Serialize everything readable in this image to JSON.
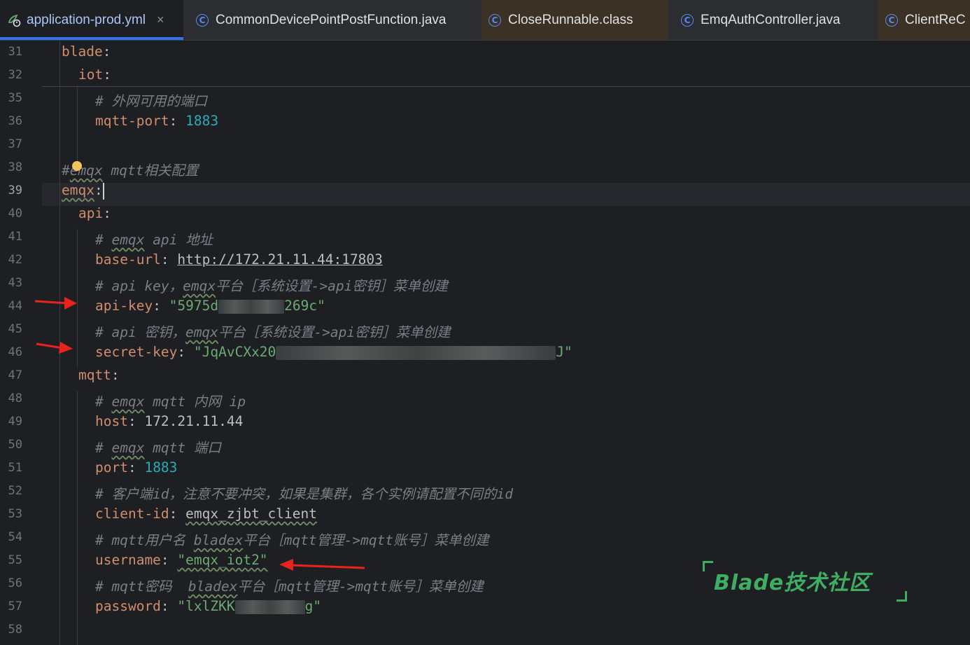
{
  "tabs": [
    {
      "label": "application-prod.yml",
      "close": "×"
    },
    {
      "label": "CommonDevicePointPostFunction.java"
    },
    {
      "label": "CloseRunnable.class"
    },
    {
      "label": "EmqAuthController.java"
    },
    {
      "label": "ClientReC"
    }
  ],
  "class_icon_glyph": "C",
  "lines": [
    {
      "n": "31",
      "indent": 0,
      "key": "blade",
      "sep": ":"
    },
    {
      "n": "32",
      "indent": 1,
      "key": "iot",
      "sep": ":"
    },
    {
      "n": "35",
      "indent": 2,
      "comment": "# 外网可用的端口"
    },
    {
      "n": "36",
      "indent": 2,
      "key": "mqtt-port",
      "sep": ": ",
      "num": "1883"
    },
    {
      "n": "37",
      "indent": 0
    },
    {
      "n": "38",
      "indent": 0,
      "comment": "#emqx mqtt相关配置"
    },
    {
      "n": "39",
      "indent": 0,
      "key": "emqx",
      "sep": ":"
    },
    {
      "n": "40",
      "indent": 1,
      "key": "api",
      "sep": ":"
    },
    {
      "n": "41",
      "indent": 2,
      "comment": "# emqx api 地址"
    },
    {
      "n": "42",
      "indent": 2,
      "key": "base-url",
      "sep": ": ",
      "link": "http://172.21.11.44:17803"
    },
    {
      "n": "43",
      "indent": 2,
      "comment": "# api key，emqx平台［系统设置->api密钥］菜单创建"
    },
    {
      "n": "44",
      "indent": 2,
      "key": "api-key",
      "sep": ": ",
      "str_a": "\"5975d",
      "str_b": "269c\""
    },
    {
      "n": "45",
      "indent": 2,
      "comment": "# api 密钥，emqx平台［系统设置->api密钥］菜单创建"
    },
    {
      "n": "46",
      "indent": 2,
      "key": "secret-key",
      "sep": ": ",
      "str_a": "\"JqAvCXx20",
      "str_b": "J\""
    },
    {
      "n": "47",
      "indent": 1,
      "key": "mqtt",
      "sep": ":"
    },
    {
      "n": "48",
      "indent": 2,
      "comment": "# emqx mqtt 内网 ip"
    },
    {
      "n": "49",
      "indent": 2,
      "key": "host",
      "sep": ": ",
      "plain": "172.21.11.44"
    },
    {
      "n": "50",
      "indent": 2,
      "comment": "# emqx mqtt 端口"
    },
    {
      "n": "51",
      "indent": 2,
      "key": "port",
      "sep": ": ",
      "num": "1883"
    },
    {
      "n": "52",
      "indent": 2,
      "comment": "# 客户端id，注意不要冲突，如果是集群，各个实例请配置不同的id"
    },
    {
      "n": "53",
      "indent": 2,
      "key": "client-id",
      "sep": ": ",
      "plain": "emqx_zjbt_client"
    },
    {
      "n": "54",
      "indent": 2,
      "comment": "# mqtt用户名 bladex平台［mqtt管理->mqtt账号］菜单创建"
    },
    {
      "n": "55",
      "indent": 2,
      "key": "username",
      "sep": ": ",
      "str": "\"emqx_iot2\""
    },
    {
      "n": "56",
      "indent": 2,
      "comment": "# mqtt密码  bladex平台［mqtt管理->mqtt账号］菜单创建"
    },
    {
      "n": "57",
      "indent": 2,
      "key": "password",
      "sep": ": ",
      "str_a": "\"lxlZKK",
      "str_b": "g\""
    },
    {
      "n": "58",
      "indent": 0
    }
  ],
  "watermark": "Blade技术社区",
  "colors": {
    "key": "#cf8e6d",
    "number": "#2aacb8",
    "string": "#6aab73",
    "comment": "#7a7e85",
    "arrow": "#e8231b",
    "watermark": "#3fae63"
  }
}
